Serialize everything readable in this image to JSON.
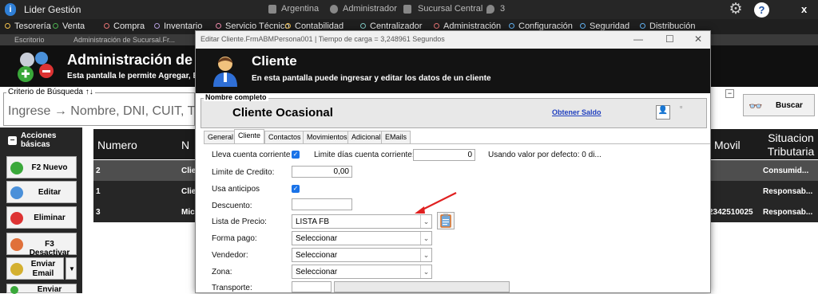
{
  "app": {
    "title": "Lider Gestión",
    "logo_icon": "info-logo-icon"
  },
  "titlebar": {
    "country": "Argentina",
    "user": "Administrador",
    "branch": "Sucursal Central",
    "location_count": "3",
    "help_label": "?",
    "close_label": "x"
  },
  "menu": [
    {
      "label": "Tesorería",
      "color": "#f2c14e"
    },
    {
      "label": "Venta",
      "color": "#4caf50"
    },
    {
      "label": "Compra",
      "color": "#e57373"
    },
    {
      "label": "Inventario",
      "color": "#b39ddb"
    },
    {
      "label": "Servicio Técnico",
      "color": "#f48fb1"
    },
    {
      "label": "Contabilidad",
      "color": "#f2c14e"
    },
    {
      "label": "Centralizador",
      "color": "#80cbc4"
    },
    {
      "label": "Administración",
      "color": "#e57373"
    },
    {
      "label": "Configuración",
      "color": "#64b5f6"
    },
    {
      "label": "Seguridad",
      "color": "#64b5f6"
    },
    {
      "label": "Distribución",
      "color": "#64b5f6"
    }
  ],
  "doc_tabs": [
    "Escritorio",
    "Administración de Sucursal.Fr..."
  ],
  "page": {
    "title": "Administración de C",
    "subtitle": "Esta pantalla le permite Agregar, El"
  },
  "search": {
    "legend": "Criterio de Búsqueda ↑↓",
    "placeholder": "Ingrese → Nombre, DNI, CUIT, T",
    "button_label": "Buscar",
    "collapse_label": "−"
  },
  "actions": {
    "header": "Acciones básicas",
    "buttons": [
      {
        "label": "F2 Nuevo",
        "icon": "add-icon",
        "color": "#3aa83a"
      },
      {
        "label": "Editar",
        "icon": "edit-icon",
        "color": "#4a90d9"
      },
      {
        "label": "Eliminar",
        "icon": "delete-icon",
        "color": "#d33"
      },
      {
        "label": "F3 Desactivar",
        "icon": "deactivate-icon",
        "color": "#e0703a"
      },
      {
        "label": "Enviar Email",
        "icon": "email-icon",
        "color": "#d4b030"
      },
      {
        "label": "Enviar",
        "icon": "send-icon",
        "color": "#3aa83a"
      }
    ]
  },
  "grid": {
    "headers": {
      "numero": "Numero",
      "nombre": "N",
      "movil": "Movil",
      "situacion": "Situacion Tributaria"
    },
    "rows": [
      {
        "numero": "2",
        "nombre": "Clie",
        "movil": "",
        "situacion": "Consumid..."
      },
      {
        "numero": "1",
        "nombre": "Clie",
        "movil": "",
        "situacion": "Responsab..."
      },
      {
        "numero": "3",
        "nombre": "Mic",
        "movil": "2342510025",
        "situacion": "Responsab..."
      }
    ]
  },
  "dialog": {
    "window_title": "Editar Cliente.FrmABMPersona001 | Tiempo de carga = 3,248961 Segundos",
    "header_title": "Cliente",
    "header_subtitle": "En esta pantalla puede ingresar y editar los datos de un cliente",
    "nombre_legend": "Nombre completo",
    "nombre": "Cliente Ocasional",
    "obtener_saldo": "Obtener Saldo",
    "tabs": [
      "General",
      "Cliente",
      "Contactos",
      "Movimientos",
      "Adicional",
      "EMails"
    ],
    "active_tab": "Cliente",
    "fields": {
      "lleva_cc_label": "Lleva cuenta corriente",
      "limite_dias_label": "Limite días cuenta corriente:",
      "limite_dias_value": "0",
      "default_hint": "Usando valor por defecto: 0 di...",
      "limite_credito_label": "Limite de Credito:",
      "limite_credito_value": "0,00",
      "usa_anticipos_label": "Usa anticipos",
      "descuento_label": "Descuento:",
      "descuento_value": "",
      "lista_precio_label": "Lista de Precio:",
      "lista_precio_value": "LISTA FB",
      "forma_pago_label": "Forma pago:",
      "forma_pago_value": "Seleccionar",
      "vendedor_label": "Vendedor:",
      "vendedor_value": "Seleccionar",
      "zona_label": "Zona:",
      "zona_value": "Seleccionar",
      "transporte_label": "Transporte:"
    },
    "check_mark": "✓",
    "dropdown_arrow": "⌄"
  },
  "annotation": {
    "arrow_color": "#e02020"
  }
}
